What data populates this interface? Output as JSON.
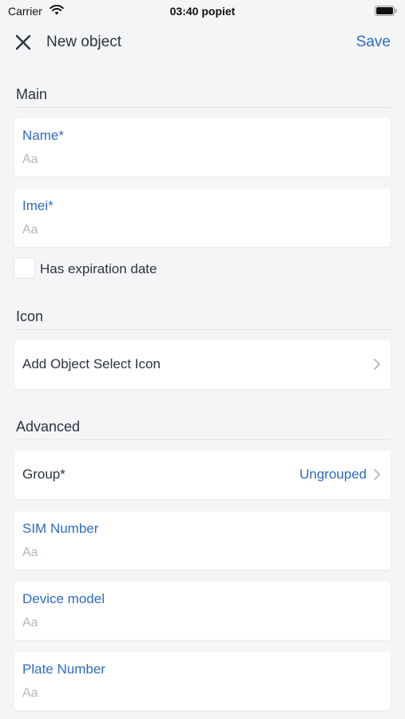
{
  "status_bar": {
    "carrier": "Carrier",
    "time": "03:40 popiet"
  },
  "nav": {
    "title": "New object",
    "save_label": "Save"
  },
  "sections": {
    "main": "Main",
    "icon": "Icon",
    "advanced": "Advanced"
  },
  "fields": {
    "name": {
      "label": "Name*",
      "placeholder": "Aa",
      "value": ""
    },
    "imei": {
      "label": "Imei*",
      "placeholder": "Aa",
      "value": ""
    },
    "sim_number": {
      "label": "SIM Number",
      "placeholder": "Aa",
      "value": ""
    },
    "device_model": {
      "label": "Device model",
      "placeholder": "Aa",
      "value": ""
    },
    "plate_number": {
      "label": "Plate Number",
      "placeholder": "Aa",
      "value": ""
    }
  },
  "has_expiration": {
    "label": "Has expiration date",
    "checked": false
  },
  "icon_row": {
    "label": "Add Object Select Icon"
  },
  "group_row": {
    "label": "Group*",
    "value": "Ungrouped"
  },
  "icons": {
    "close": "close-icon",
    "chevron": "chevron-right-icon",
    "wifi": "wifi-icon",
    "battery": "battery-icon"
  },
  "colors": {
    "accent": "#2f6bbd",
    "background": "#f4f5f7",
    "card": "#ffffff",
    "placeholder": "#b2b7bf",
    "text": "#2c3340"
  }
}
